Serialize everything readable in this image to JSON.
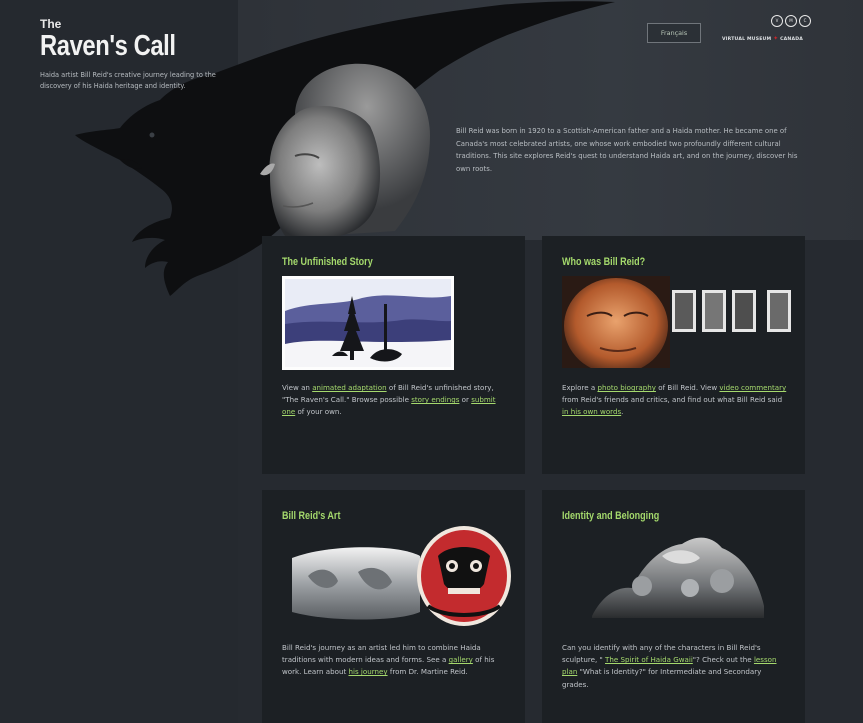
{
  "header": {
    "the": "The",
    "title": "Raven's Call",
    "tagline": "Haida artist Bill Reid's creative journey leading to the discovery of his Haida heritage and identity.",
    "language_button": "Français",
    "vmc_label": "VIRTUAL MUSEUM",
    "vmc_country": "CANADA",
    "vmc_logo_letters": [
      "V",
      "M",
      "C"
    ]
  },
  "intro": "Bill Reid was born in 1920 to a Scottish-American father and a Haida mother. He became one of Canada's most celebrated artists, one whose work embodied two profoundly different cultural traditions. This site explores Reid's quest to understand Haida art, and on the journey, discover his own roots.",
  "panels": {
    "unfinished": {
      "title": "The Unfinished Story",
      "t1": "View an ",
      "l1": "animated adaptation",
      "t2": " of Bill Reid's unfinished story, \"The Raven's Call.\" Browse possible ",
      "l2": "story endings",
      "t3": " or ",
      "l3": "submit one",
      "t4": " of your own."
    },
    "who": {
      "title": "Who was Bill Reid?",
      "t1": "Explore a ",
      "l1": "photo biography",
      "t2": " of Bill Reid. View ",
      "l2": "video commentary",
      "t3": " from Reid's friends and critics, and find out what Bill Reid said ",
      "l3": "in his own words",
      "t4": "."
    },
    "art": {
      "title": "Bill Reid's Art",
      "t1": "Bill Reid's journey as an artist led him to combine Haida traditions with modern ideas and forms. See a ",
      "l1": "gallery",
      "t2": " of his work. Learn about ",
      "l2": "his journey",
      "t3": " from Dr. Martine Reid."
    },
    "identity": {
      "title": "Identity and Belonging",
      "t1": "Can you identify with any of the characters in Bill Reid's sculpture, \" ",
      "l1": "The Spirit of Haida Gwaii",
      "t2": "\"? Check out the ",
      "l2": "lesson plan",
      "t3": " \"What is Identity?\" for Intermediate and Secondary grades."
    }
  },
  "colors": {
    "accent_green": "#a4d96c",
    "background": "#262a30",
    "panel": "#1c2024"
  }
}
